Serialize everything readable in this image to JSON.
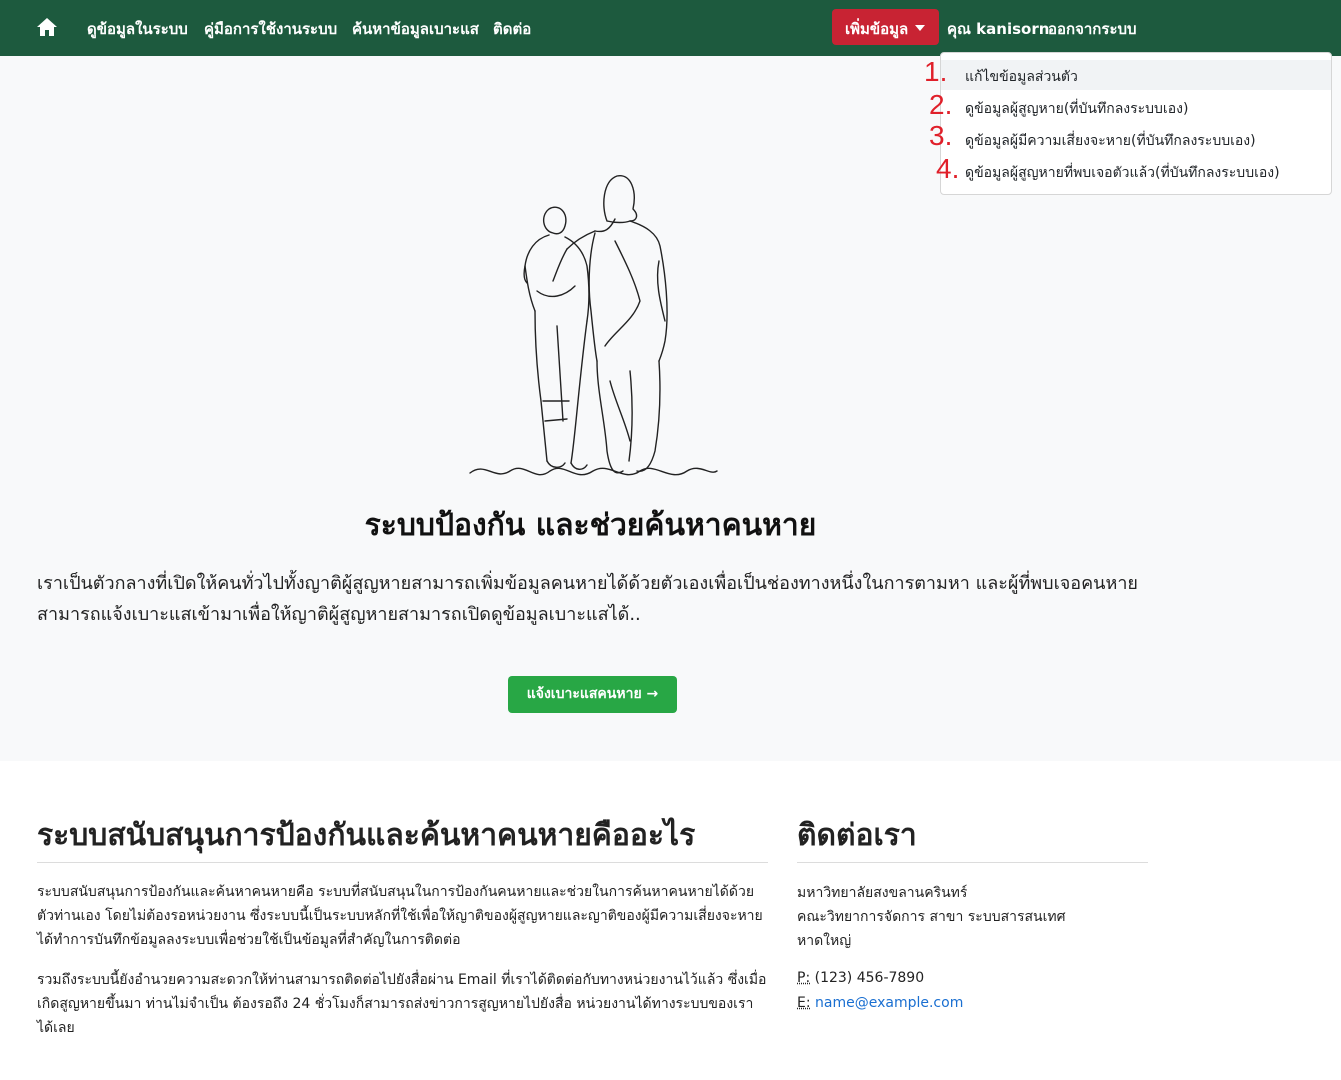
{
  "nav": {
    "home_icon": "home-icon",
    "links": [
      "ดูข้อมูลในระบบ",
      "คู่มือการใช้งานระบบ",
      "ค้นหาข้อมูลเบาะแส",
      "ติดต่อ"
    ],
    "dropdown_label": "เพิ่มข้อมูล",
    "user": "คุณ kanisorn",
    "logout": "ออกจากระบบ"
  },
  "dropdown": {
    "items": [
      "แก้ไขข้อมูลส่วนตัว",
      "ดูข้อมูลผู้สูญหาย(ที่บันทึกลงระบบเอง)",
      "ดูข้อมูลผู้มีความเสี่ยงจะหาย(ที่บันทึกลงระบบเอง)",
      "ดูข้อมูลผู้สูญหายที่พบเจอตัวแล้ว(ที่บันทึกลงระบบเอง)"
    ],
    "annotations": [
      "1.",
      "2.",
      "3.",
      "4."
    ]
  },
  "hero": {
    "title": "ระบบป้องกัน และช่วยค้นหาคนหาย",
    "text": "เราเป็นตัวกลางที่เปิดให้คนทั่วไปทั้งญาติผู้สูญหายสามารถเพิ่มข้อมูลคนหายได้ด้วยตัวเองเพื่อเป็นช่องทางหนึ่งในการตามหา และผู้ที่พบเจอคนหายสามารถแจ้งเบาะแสเข้ามาเพื่อให้ญาติผู้สูญหายสามารถเปิดดูข้อมูลเบาะแสได้..",
    "button": "แจ้งเบาะแสคนหาย →"
  },
  "about": {
    "title": "ระบบสนับสนุนการป้องกันและค้นหาคนหายคืออะไร",
    "p1": "ระบบสนับสนุนการป้องกันและค้นหาคนหายคือ ระบบที่สนับสนุนในการป้องกันคนหายและช่วยในการค้นหาคนหายได้ด้วยตัวท่านเอง โดยไม่ต้องรอหน่วยงาน ซึ่งระบบนี้เป็นระบบหลักที่ใช้เพื่อให้ญาติของผู้สูญหายและญาติของผู้มีความเสี่ยงจะหายได้ทำการบันทึกข้อมูลลงระบบเพื่อช่วยใช้เป็นข้อมูลที่สำคัญในการติดต่อ",
    "p2": "รวมถึงระบบนี้ยังอำนวยความสะดวกให้ท่านสามารถติดต่อไปยังสื่อผ่าน Email ที่เราได้ติดต่อกับทางหน่วยงานไว้แล้ว ซึ่งเมื่อเกิดสูญหายขึ้นมา ท่านไม่จำเป็น ต้องรอถึง 24 ชั่วโมงก็สามารถส่งข่าวการสูญหายไปยังสื่อ หน่วยงานได้ทางระบบของเราได้เลย"
  },
  "contact": {
    "title": "ติดต่อเรา",
    "lines": [
      "มหาวิทยาลัยสงขลานครินทร์",
      "คณะวิทยาการจัดการ สาขา ระบบสารสนเทศ",
      "หาดใหญ่"
    ],
    "phone_label": "P:",
    "phone": "(123) 456-7890",
    "email_label": "E:",
    "email": "name@example.com"
  },
  "colors": {
    "navbar": "#1d5a3e",
    "dropdown_button": "#c82333",
    "cta": "#28a745",
    "annotation": "#e0202a",
    "link": "#1a6fd1"
  }
}
